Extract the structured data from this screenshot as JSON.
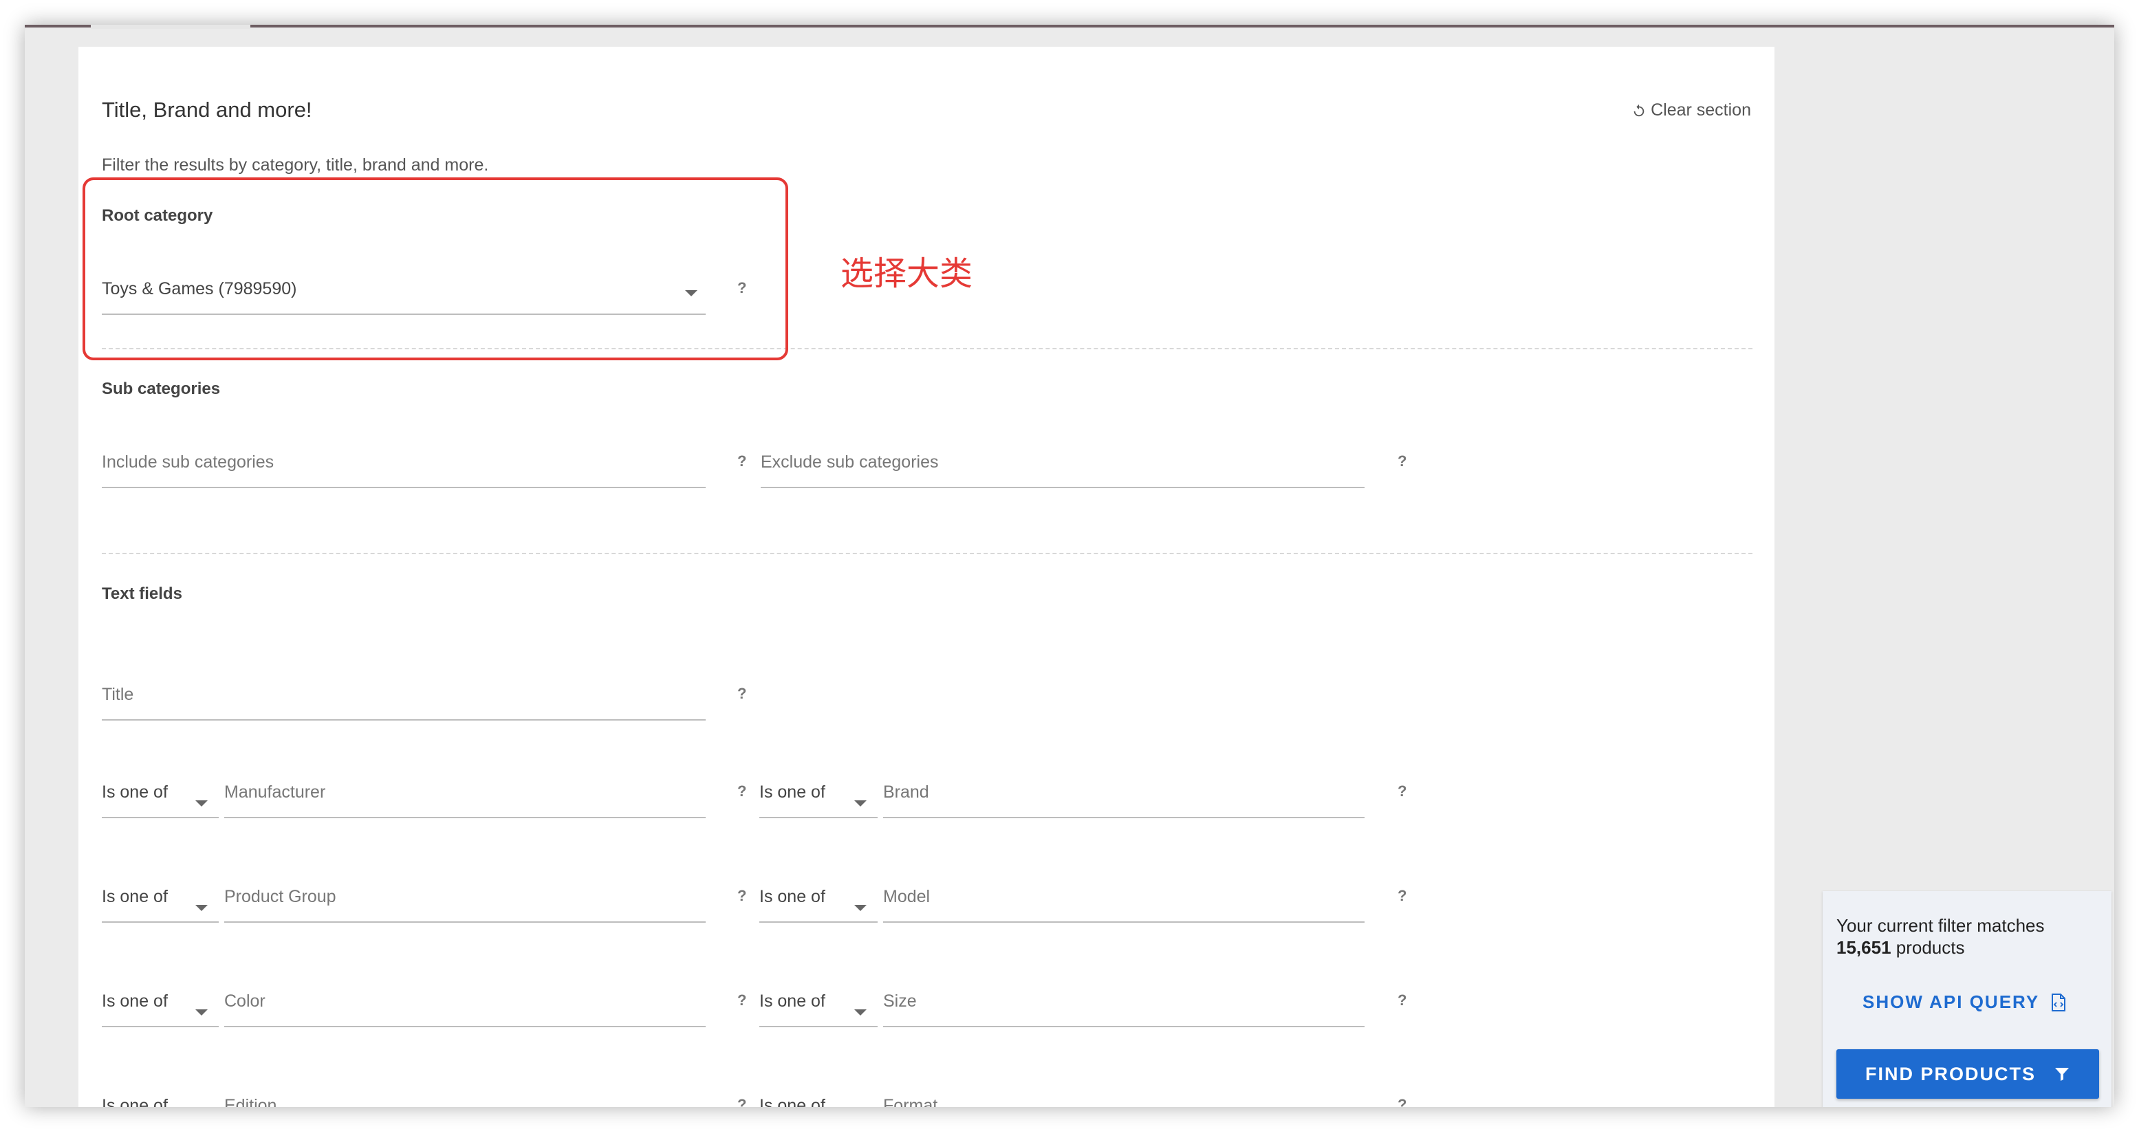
{
  "section": {
    "title": "Title, Brand and more!",
    "clear_label": "Clear section",
    "subtitle": "Filter the results by category, title, brand and more."
  },
  "root_category": {
    "label": "Root category",
    "value": "Toys & Games (7989590)",
    "help": "?"
  },
  "sub_categories": {
    "label": "Sub categories",
    "include_placeholder": "Include sub categories",
    "exclude_placeholder": "Exclude sub categories",
    "help": "?"
  },
  "text_fields": {
    "label": "Text fields",
    "title_placeholder": "Title",
    "help": "?",
    "rows": [
      {
        "left_op": "Is one of",
        "left_field": "Manufacturer",
        "right_op": "Is one of",
        "right_field": "Brand"
      },
      {
        "left_op": "Is one of",
        "left_field": "Product Group",
        "right_op": "Is one of",
        "right_field": "Model"
      },
      {
        "left_op": "Is one of",
        "left_field": "Color",
        "right_op": "Is one of",
        "right_field": "Size"
      },
      {
        "left_op": "Is one of",
        "left_field": "Edition",
        "right_op": "Is one of",
        "right_field": "Format"
      }
    ]
  },
  "annotation": {
    "text": "选择大类",
    "color": "#e53935"
  },
  "results_panel": {
    "match_prefix": "Your current filter matches",
    "match_count": "15,651",
    "match_suffix": "products",
    "api_query_label": "SHOW API QUERY",
    "find_label": "FIND PRODUCTS"
  },
  "colors": {
    "accent": "#1e6bd0",
    "annotation": "#e53935"
  },
  "icons": {
    "clear": "refresh-icon",
    "api": "code-file-icon",
    "find": "filter-icon",
    "dropdown": "caret-down-icon"
  }
}
